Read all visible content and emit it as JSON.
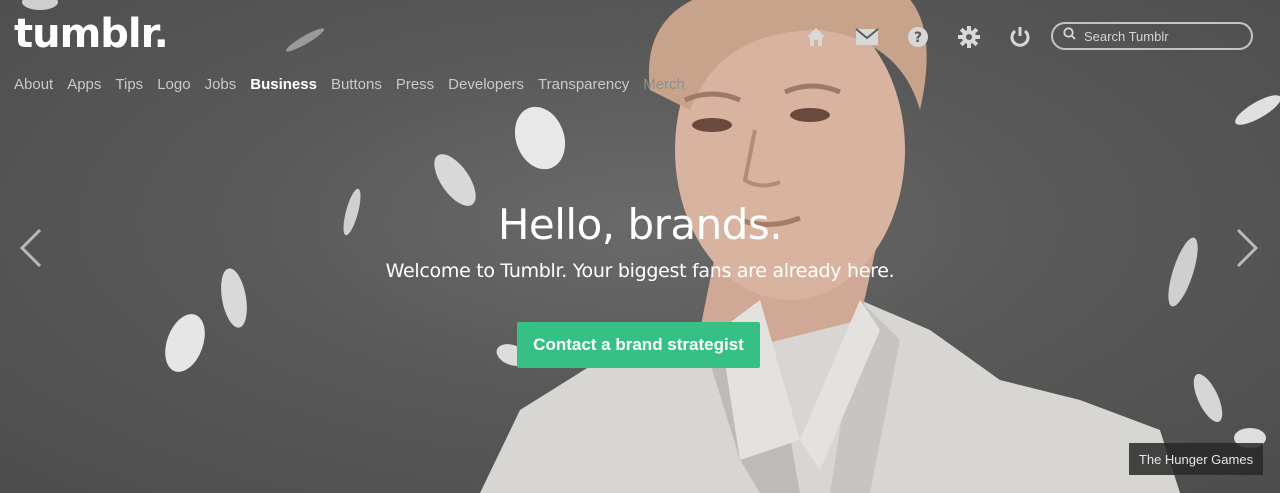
{
  "brand": {
    "logo_text": "tumblr."
  },
  "nav": {
    "items": [
      {
        "label": "About"
      },
      {
        "label": "Apps"
      },
      {
        "label": "Tips"
      },
      {
        "label": "Logo"
      },
      {
        "label": "Jobs"
      },
      {
        "label": "Business",
        "active": true
      },
      {
        "label": "Buttons"
      },
      {
        "label": "Press"
      },
      {
        "label": "Developers"
      },
      {
        "label": "Transparency"
      },
      {
        "label": "Merch"
      }
    ]
  },
  "header_icons": [
    "home-icon",
    "mail-icon",
    "help-icon",
    "settings-gear-icon",
    "power-icon"
  ],
  "search": {
    "placeholder": "Search Tumblr"
  },
  "hero": {
    "headline": "Hello, brands.",
    "subhead": "Welcome to Tumblr. Your biggest fans are already here.",
    "cta_label": "Contact a brand strategist",
    "cta_color": "#37c086",
    "image_credit": "The Hunger Games"
  }
}
